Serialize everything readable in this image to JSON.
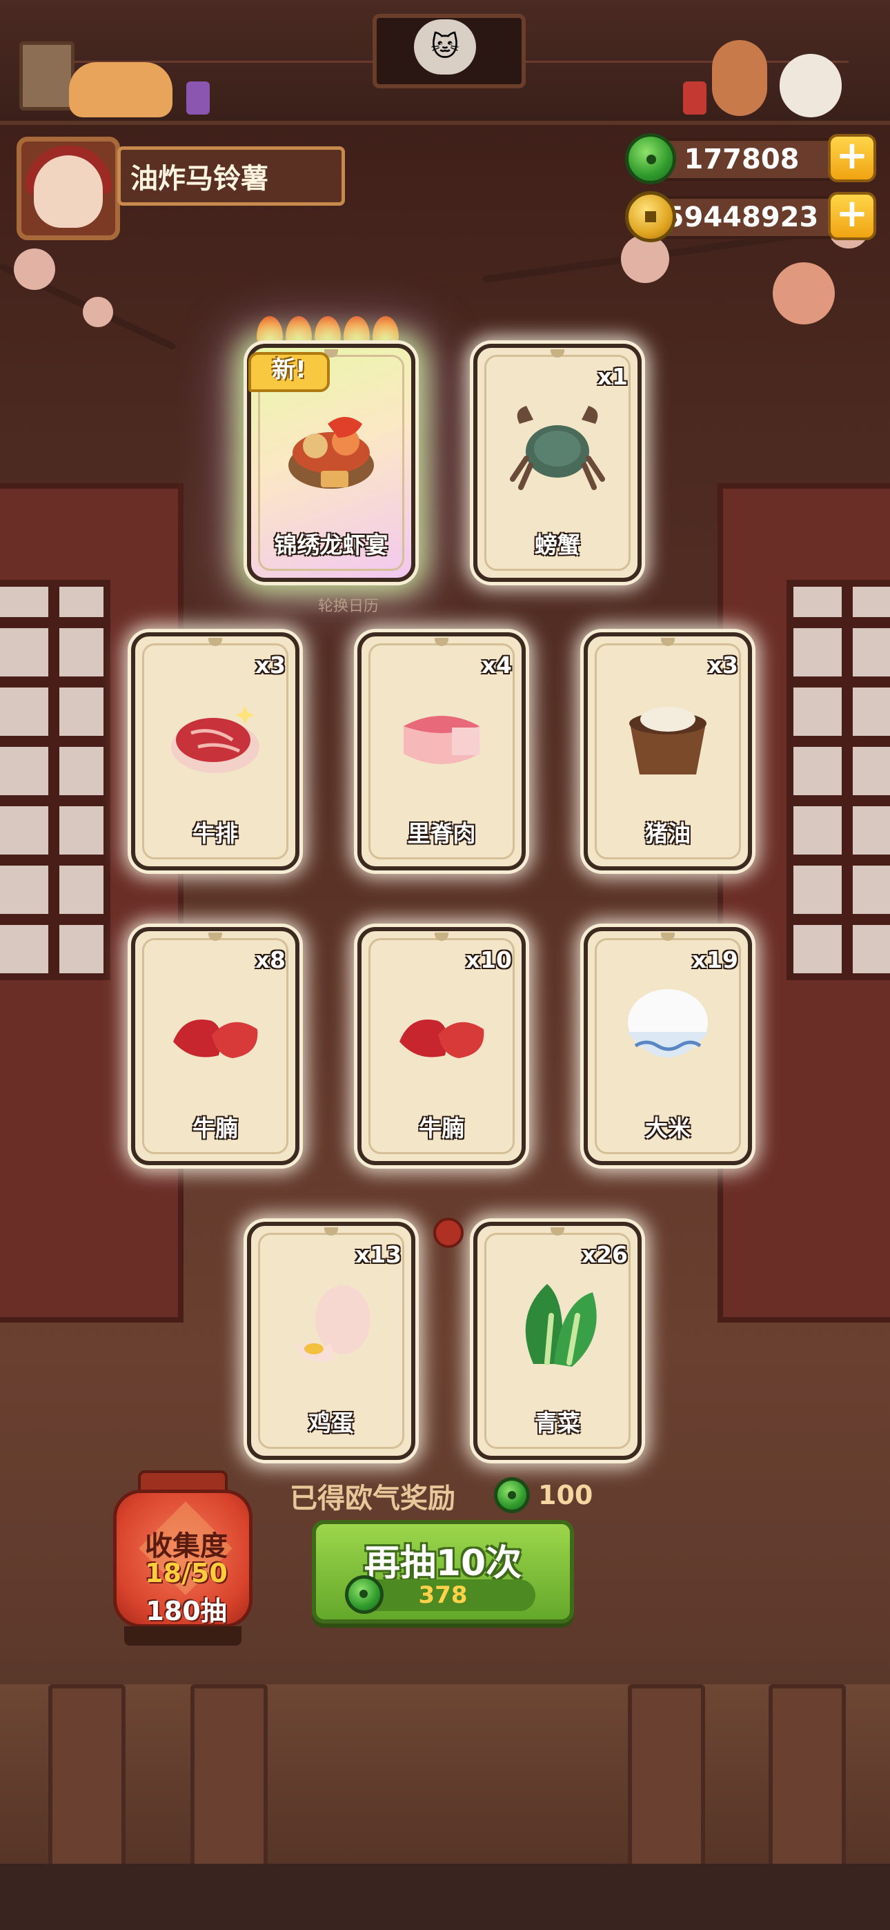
{
  "player": {
    "name": "油炸马铃薯"
  },
  "currency": {
    "jade": "177808",
    "coins": "59448923",
    "add_symbol": "+"
  },
  "featured": {
    "badge": "新!",
    "flames": 5,
    "calendar_label": "轮换日历"
  },
  "cards": [
    {
      "label": "锦绣龙虾宴",
      "count": "",
      "icon": "lobster-feast-icon",
      "rare": true
    },
    {
      "label": "螃蟹",
      "count": "x1",
      "icon": "crab-icon"
    },
    {
      "label": "牛排",
      "count": "x3",
      "icon": "steak-icon"
    },
    {
      "label": "里脊肉",
      "count": "x4",
      "icon": "tenderloin-icon"
    },
    {
      "label": "猪油",
      "count": "x3",
      "icon": "lard-icon"
    },
    {
      "label": "牛腩",
      "count": "x8",
      "icon": "beef-brisket-icon"
    },
    {
      "label": "牛腩",
      "count": "x10",
      "icon": "beef-brisket-icon"
    },
    {
      "label": "大米",
      "count": "x19",
      "icon": "rice-bowl-icon"
    },
    {
      "label": "鸡蛋",
      "count": "x13",
      "icon": "egg-icon"
    },
    {
      "label": "青菜",
      "count": "x26",
      "icon": "bok-choy-icon"
    }
  ],
  "reward": {
    "label": "已得欧气奖励",
    "value": "100"
  },
  "draw_button": {
    "label": "再抽10次",
    "cost": "378"
  },
  "collection": {
    "title": "收集度",
    "progress": "18/50",
    "draws": "180抽"
  },
  "colors": {
    "jade": "#2f9a2c",
    "coin": "#e0a521",
    "button_green": "#7cbf36",
    "lantern_red": "#d8432c"
  }
}
